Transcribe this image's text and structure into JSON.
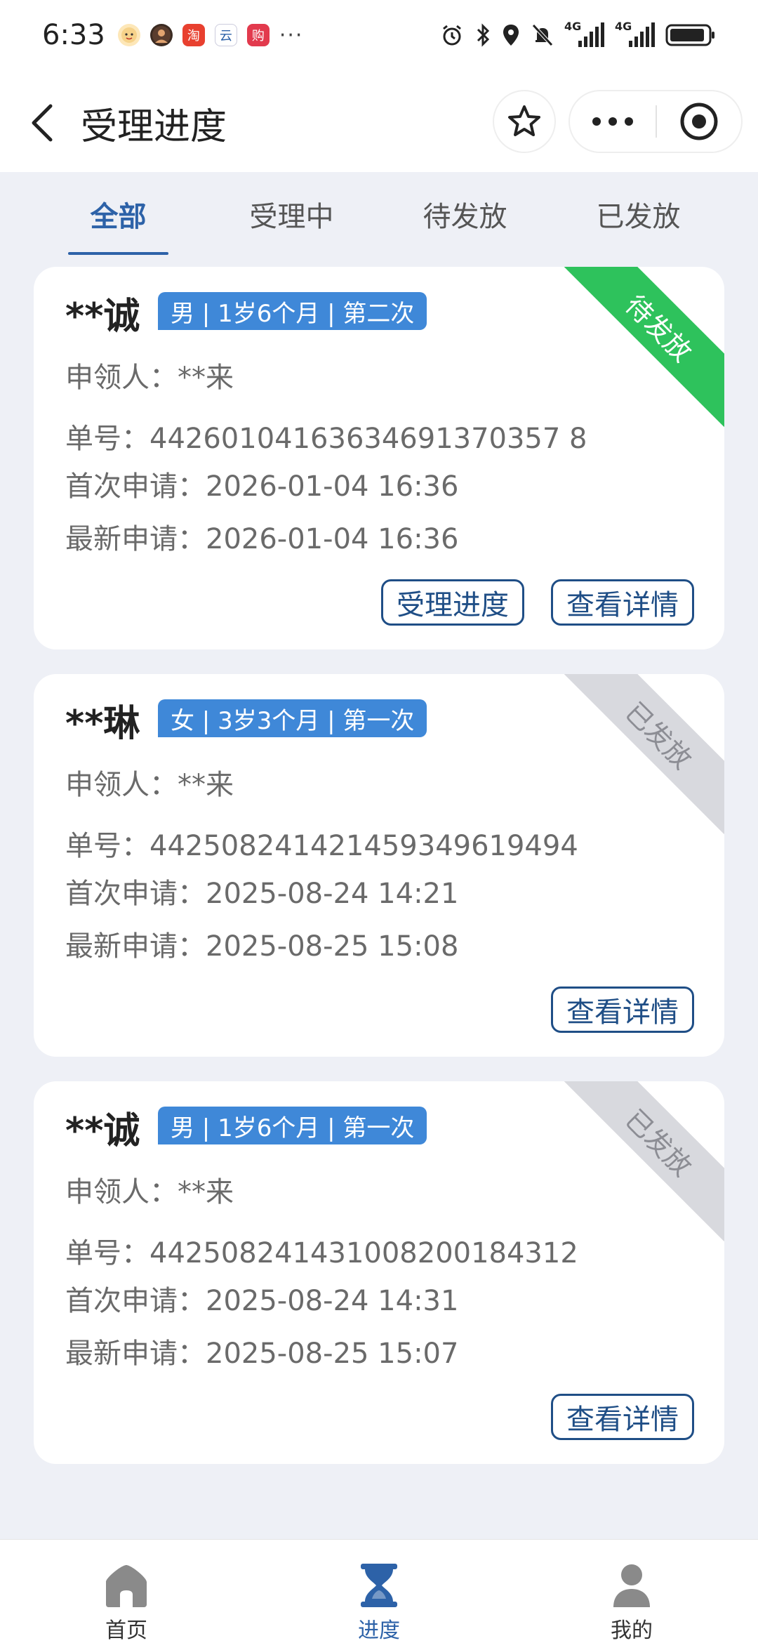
{
  "status_bar": {
    "time": "6:33",
    "notif_icons": [
      "baby-face-icon",
      "avatar-icon",
      "taobao-icon",
      "cloud-app-icon",
      "shop-app-icon"
    ],
    "notif_labels": {
      "taobao": "淘",
      "cloud": "云",
      "shop": "购"
    },
    "more": "···",
    "net1": "4G",
    "net2": "4G"
  },
  "header": {
    "title": "受理进度"
  },
  "tabs": [
    {
      "label": "全部",
      "active": true
    },
    {
      "label": "受理中",
      "active": false
    },
    {
      "label": "待发放",
      "active": false
    },
    {
      "label": "已发放",
      "active": false
    }
  ],
  "labels": {
    "applicant": "申领人：",
    "number": "单号：",
    "first": "首次申请：",
    "latest": "最新申请："
  },
  "cards": [
    {
      "name": "**诚",
      "tag": "男 | 1岁6个月 | 第二次",
      "applicant": "**来",
      "number": "44260104163634691370357 8",
      "first": "2026-01-04 16:36",
      "latest": "2026-01-04 16:36",
      "status": "待发放",
      "status_kind": "pending",
      "buttons": [
        "受理进度",
        "查看详情"
      ]
    },
    {
      "name": "**琳",
      "tag": "女 | 3岁3个月 | 第一次",
      "applicant": "**来",
      "number": "442508241421459349619494",
      "first": "2025-08-24 14:21",
      "latest": "2025-08-25 15:08",
      "status": "已发放",
      "status_kind": "done",
      "buttons": [
        "查看详情"
      ]
    },
    {
      "name": "**诚",
      "tag": "男 | 1岁6个月 | 第一次",
      "applicant": "**来",
      "number": "442508241431008200184312",
      "first": "2025-08-24 14:31",
      "latest": "2025-08-25 15:07",
      "status": "已发放",
      "status_kind": "done",
      "buttons": [
        "查看详情"
      ]
    }
  ],
  "bottom_nav": [
    {
      "label": "首页",
      "icon": "home-icon",
      "active": false
    },
    {
      "label": "进度",
      "icon": "hourglass-icon",
      "active": true
    },
    {
      "label": "我的",
      "icon": "user-icon",
      "active": false
    }
  ],
  "colors": {
    "primary": "#2d62a8",
    "tag": "#3f88d8",
    "pending": "#2ec25c",
    "done": "#d8d9de",
    "background": "#eef0f6"
  }
}
